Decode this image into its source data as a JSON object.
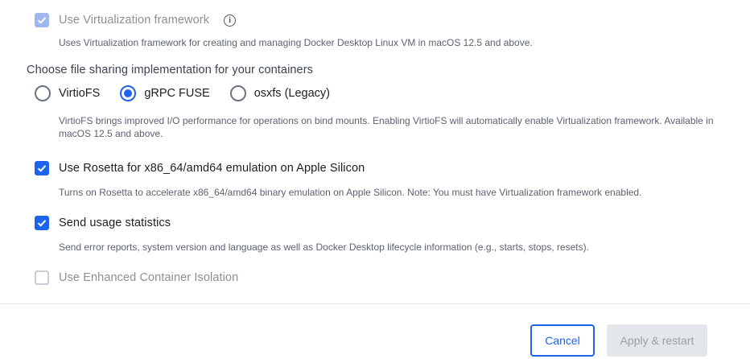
{
  "settings": {
    "virtualization": {
      "label": "Use Virtualization framework",
      "description": "Uses Virtualization framework for creating and managing Docker Desktop Linux VM in macOS 12.5 and above.",
      "checked": true,
      "disabled": true,
      "info_icon": "info-circle-icon"
    },
    "file_sharing": {
      "title": "Choose file sharing implementation for your containers",
      "options": [
        {
          "label": "VirtioFS",
          "selected": false
        },
        {
          "label": "gRPC FUSE",
          "selected": true
        },
        {
          "label": "osxfs (Legacy)",
          "selected": false
        }
      ],
      "description": "VirtioFS brings improved I/O performance for operations on bind mounts. Enabling VirtioFS will automatically enable Virtualization framework. Available in macOS 12.5 and above."
    },
    "rosetta": {
      "label": "Use Rosetta for x86_64/amd64 emulation on Apple Silicon",
      "description": "Turns on Rosetta to accelerate x86_64/amd64 binary emulation on Apple Silicon. Note: You must have Virtualization framework enabled.",
      "checked": true
    },
    "usage_stats": {
      "label": "Send usage statistics",
      "description": "Send error reports, system version and language as well as Docker Desktop lifecycle information (e.g., starts, stops, resets).",
      "checked": true
    },
    "eci": {
      "label": "Use Enhanced Container Isolation",
      "checked": false,
      "disabled": true
    }
  },
  "footer": {
    "cancel_label": "Cancel",
    "apply_label": "Apply & restart"
  },
  "colors": {
    "accent": "#1d63ed",
    "disabled_check": "#9fb6ee",
    "disabled_button_bg": "#e3e6ea"
  }
}
